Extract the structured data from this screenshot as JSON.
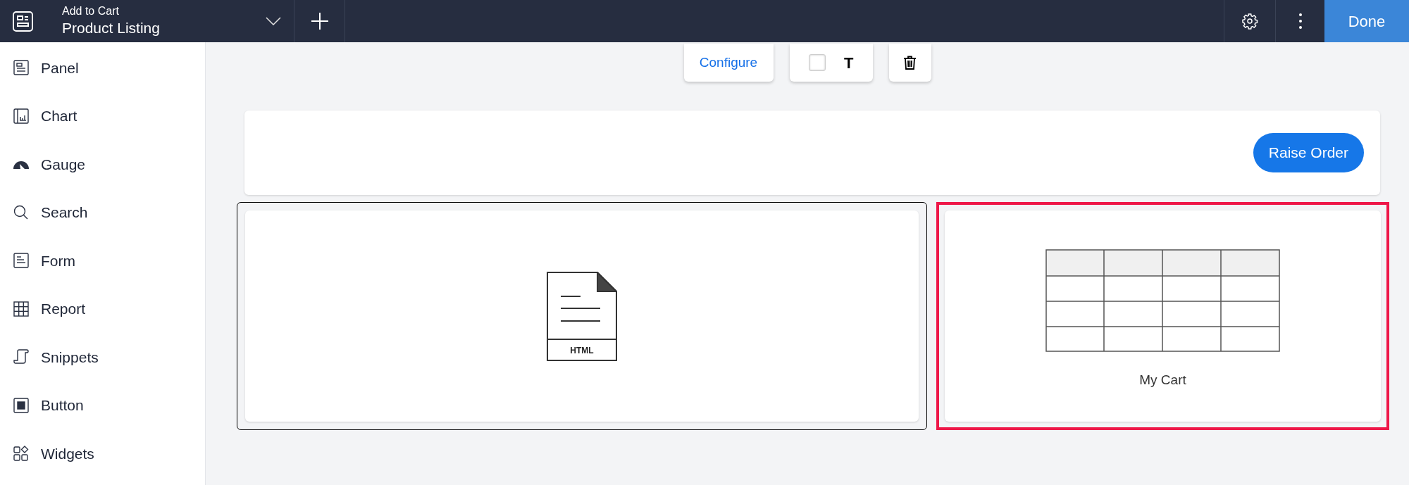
{
  "header": {
    "subtitle": "Add to Cart",
    "title": "Product Listing",
    "done": "Done"
  },
  "sidebar": {
    "items": [
      {
        "kind": "panel",
        "label": "Panel"
      },
      {
        "kind": "chart",
        "label": "Chart"
      },
      {
        "kind": "gauge",
        "label": "Gauge"
      },
      {
        "kind": "search",
        "label": "Search"
      },
      {
        "kind": "form",
        "label": "Form"
      },
      {
        "kind": "report",
        "label": "Report"
      },
      {
        "kind": "snippets",
        "label": "Snippets"
      },
      {
        "kind": "button",
        "label": "Button"
      },
      {
        "kind": "widgets",
        "label": "Widgets"
      }
    ]
  },
  "toolbar": {
    "configure": "Configure",
    "checkbox": {
      "checked": false
    },
    "text_tool": "T"
  },
  "top_card": {
    "button": "Raise Order"
  },
  "widgets": [
    {
      "kind": "html",
      "label": "HTML",
      "selected": true,
      "highlighted": false
    },
    {
      "kind": "table",
      "label": "My Cart",
      "selected": false,
      "highlighted": true
    }
  ]
}
